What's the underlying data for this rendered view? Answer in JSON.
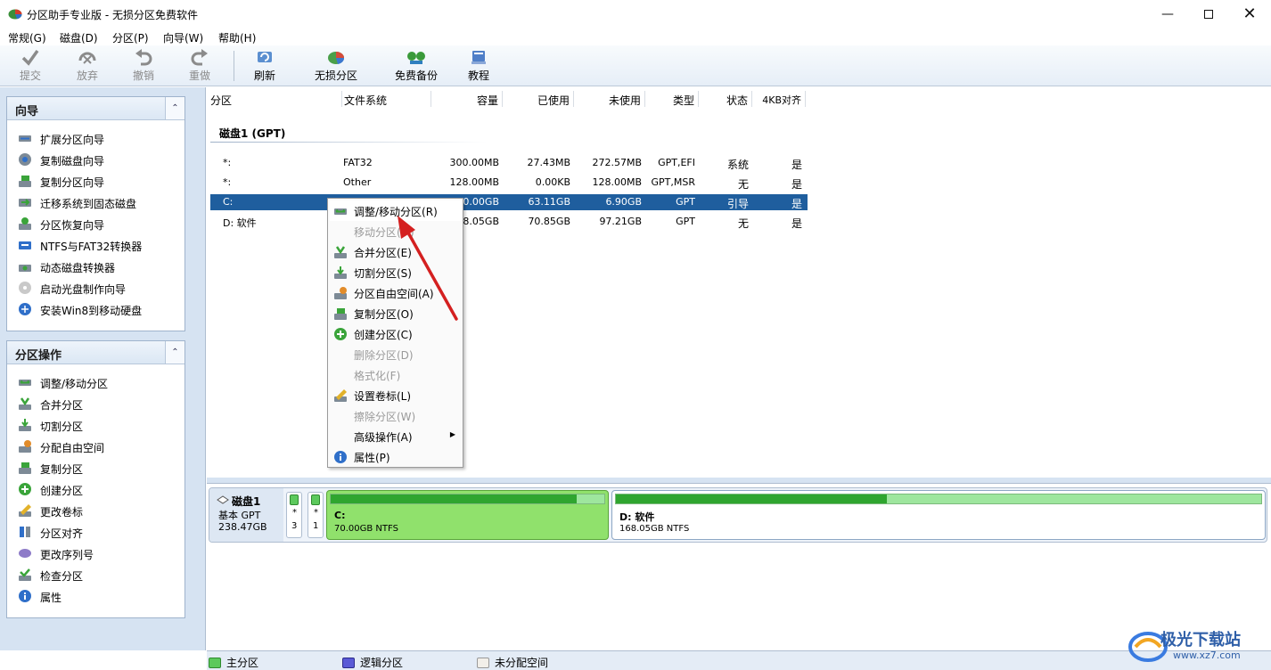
{
  "window": {
    "title": "分区助手专业版 - 无损分区免费软件",
    "minimize_icon": "minimize-icon",
    "maximize_icon": "maximize-icon",
    "close_icon": "close-icon"
  },
  "menu": [
    "常规(G)",
    "磁盘(D)",
    "分区(P)",
    "向导(W)",
    "帮助(H)"
  ],
  "toolbar": {
    "submit": "提交",
    "discard": "放弃",
    "undo": "撤销",
    "redo": "重做",
    "refresh": "刷新",
    "lossless": "无损分区",
    "backup": "免费备份",
    "tutorial": "教程"
  },
  "sidebar": {
    "wizard_title": "向导",
    "wizard_items": [
      "扩展分区向导",
      "复制磁盘向导",
      "复制分区向导",
      "迁移系统到固态磁盘",
      "分区恢复向导",
      "NTFS与FAT32转换器",
      "动态磁盘转换器",
      "启动光盘制作向导",
      "安装Win8到移动硬盘"
    ],
    "ops_title": "分区操作",
    "ops_items": [
      "调整/移动分区",
      "合并分区",
      "切割分区",
      "分配自由空间",
      "复制分区",
      "创建分区",
      "更改卷标",
      "分区对齐",
      "更改序列号",
      "检查分区",
      "属性"
    ]
  },
  "table": {
    "headers": [
      "分区",
      "文件系统",
      "容量",
      "已使用",
      "未使用",
      "类型",
      "状态",
      "4KB对齐"
    ],
    "disk_title": "磁盘1 (GPT)",
    "rows": [
      {
        "partition": "*:",
        "fs": "FAT32",
        "capacity": "300.00MB",
        "used": "27.43MB",
        "free": "272.57MB",
        "type": "GPT,EFI",
        "status": "系统",
        "align": "是"
      },
      {
        "partition": "*:",
        "fs": "Other",
        "capacity": "128.00MB",
        "used": "0.00KB",
        "free": "128.00MB",
        "type": "GPT,MSR",
        "status": "无",
        "align": "是"
      },
      {
        "partition": "C:",
        "fs": "",
        "capacity": "70.00GB",
        "used": "63.11GB",
        "free": "6.90GB",
        "type": "GPT",
        "status": "引导",
        "align": "是"
      },
      {
        "partition": "D: 软件",
        "fs": "",
        "capacity": "168.05GB",
        "used": "70.85GB",
        "free": "97.21GB",
        "type": "GPT",
        "status": "无",
        "align": "是"
      }
    ]
  },
  "context_menu": [
    {
      "label": "调整/移动分区(R)",
      "enabled": true,
      "icon": "resize-icon"
    },
    {
      "label": "移动分区(M)",
      "enabled": false,
      "icon": ""
    },
    {
      "label": "合并分区(E)",
      "enabled": true,
      "icon": "merge-icon"
    },
    {
      "label": "切割分区(S)",
      "enabled": true,
      "icon": "split-icon"
    },
    {
      "label": "分区自由空间(A)",
      "enabled": true,
      "icon": "allocate-icon"
    },
    {
      "label": "复制分区(O)",
      "enabled": true,
      "icon": "copy-icon"
    },
    {
      "label": "创建分区(C)",
      "enabled": true,
      "icon": "create-icon"
    },
    {
      "label": "删除分区(D)",
      "enabled": false,
      "icon": ""
    },
    {
      "label": "格式化(F)",
      "enabled": false,
      "icon": ""
    },
    {
      "label": "设置卷标(L)",
      "enabled": true,
      "icon": "label-icon"
    },
    {
      "label": "擦除分区(W)",
      "enabled": false,
      "icon": ""
    },
    {
      "label": "高级操作(A)",
      "enabled": true,
      "icon": "",
      "submenu": true
    },
    {
      "label": "属性(P)",
      "enabled": true,
      "icon": "info-icon"
    }
  ],
  "diskmap": {
    "disk_name": "磁盘1",
    "disk_type": "基本 GPT",
    "disk_size": "238.47GB",
    "small_parts": [
      {
        "a": "*",
        "b": "3"
      },
      {
        "a": "*",
        "b": "1"
      }
    ],
    "c_name": "C:",
    "c_info": "70.00GB NTFS",
    "c_used_fraction": 0.9,
    "d_name": "D: 软件",
    "d_info": "168.05GB NTFS",
    "d_used_fraction": 0.42
  },
  "status": {
    "primary": "主分区",
    "logical": "逻辑分区",
    "unallocated": "未分配空间"
  },
  "watermark": {
    "brand": "极光下载站",
    "url": "www.xz7.com"
  },
  "colors": {
    "selection": "#1f5e9e",
    "primary_partition": "#5cc95c",
    "logical_partition": "#5a5ad6",
    "unallocated": "#f2efe9",
    "annotation_arrow": "#d42020"
  }
}
